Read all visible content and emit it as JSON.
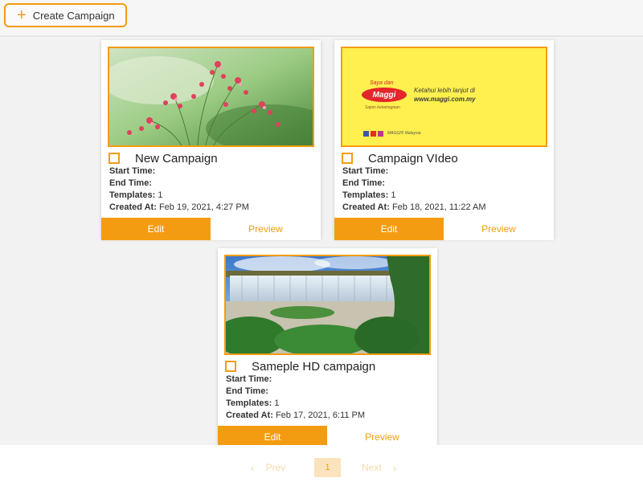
{
  "toolbar": {
    "create_label": "Create Campaign"
  },
  "campaigns": [
    {
      "title": "New Campaign",
      "start_label": "Start Time:",
      "start_value": "",
      "end_label": "End Time:",
      "end_value": "",
      "templates_label": "Templates:",
      "templates_value": "1",
      "created_label": "Created At:",
      "created_value": "Feb 19, 2021, 4:27 PM",
      "edit_label": "Edit",
      "preview_label": "Preview"
    },
    {
      "title": "Campaign VIdeo",
      "start_label": "Start Time:",
      "start_value": "",
      "end_label": "End Time:",
      "end_value": "",
      "templates_label": "Templates:",
      "templates_value": "1",
      "created_label": "Created At:",
      "created_value": "Feb 18, 2021, 11:22 AM",
      "edit_label": "Edit",
      "preview_label": "Preview",
      "ad": {
        "brand_top": "Saya dan",
        "brand": "Maggi",
        "brand_tag": "Sajian kebahagiaan",
        "line1": "Ketahui lebih lanjut di",
        "line2": "www.maggi.com.my",
        "footer": "MAGGI® Malaysia"
      }
    },
    {
      "title": "Sameple HD campaign",
      "start_label": "Start Time:",
      "start_value": "",
      "end_label": "End Time:",
      "end_value": "",
      "templates_label": "Templates:",
      "templates_value": "1",
      "created_label": "Created At:",
      "created_value": "Feb 17, 2021, 6:11 PM",
      "edit_label": "Edit",
      "preview_label": "Preview"
    }
  ],
  "pagination": {
    "prev": "Prev",
    "page": "1",
    "next": "Next"
  },
  "colors": {
    "accent": "#f39c12",
    "ad_bg": "#fff04f",
    "maggi_red": "#e3262b"
  }
}
